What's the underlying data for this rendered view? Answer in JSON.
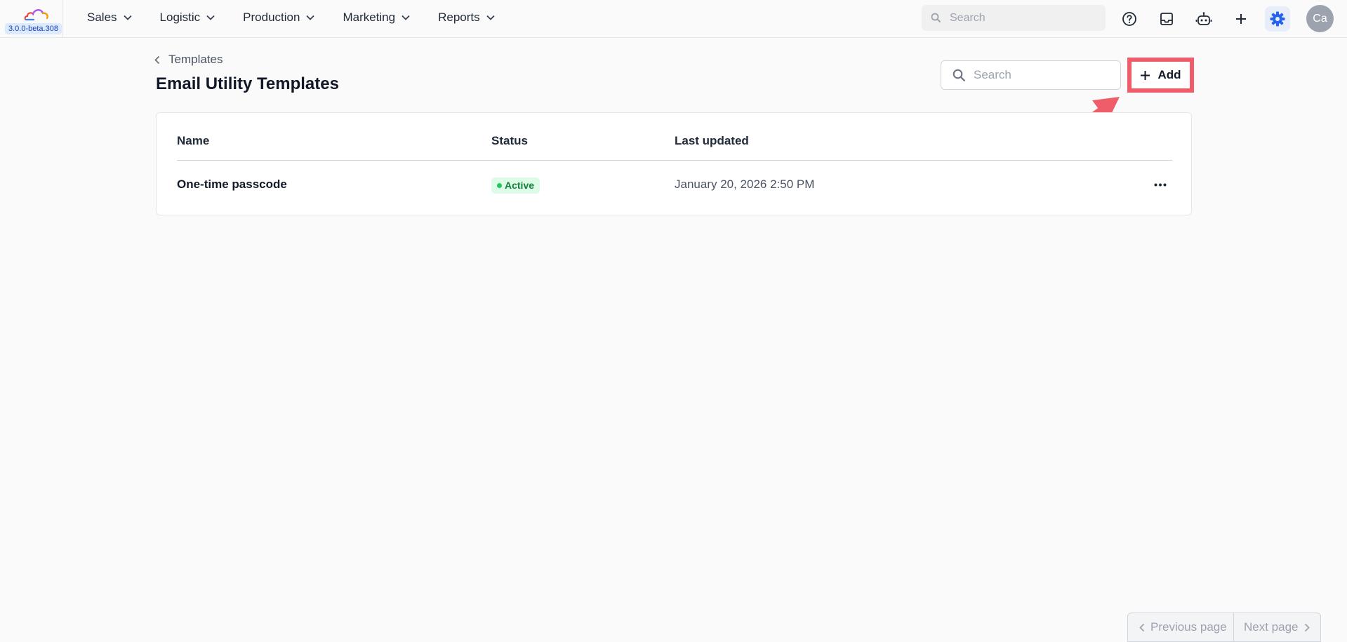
{
  "app": {
    "version": "3.0.0-beta.308"
  },
  "nav": {
    "items": [
      {
        "label": "Sales",
        "icon": "chevron-down-icon"
      },
      {
        "label": "Logistic",
        "icon": "chevron-down-icon"
      },
      {
        "label": "Production",
        "icon": "chevron-down-icon"
      },
      {
        "label": "Marketing",
        "icon": "chevron-down-icon"
      },
      {
        "label": "Reports",
        "icon": "chevron-down-icon"
      }
    ]
  },
  "topbar": {
    "search_placeholder": "Search",
    "icons": [
      "help-icon",
      "inbox-icon",
      "bot-icon",
      "plus-icon",
      "gear-icon"
    ],
    "avatar_initials": "Ca"
  },
  "page": {
    "breadcrumb": "Templates",
    "title": "Email Utility Templates",
    "search_placeholder": "Search",
    "add_label": "Add"
  },
  "table": {
    "columns": [
      "Name",
      "Status",
      "Last updated"
    ],
    "rows": [
      {
        "name": "One-time passcode",
        "status": "Active",
        "last_updated": "January 20, 2026 2:50 PM"
      }
    ]
  },
  "pagination": {
    "previous_label": "Previous page",
    "next_label": "Next page"
  },
  "colors": {
    "accent": "#2563eb",
    "annotation": "#ef5d6a",
    "status_active_bg": "#dcfce7",
    "status_active_text": "#15803d"
  }
}
